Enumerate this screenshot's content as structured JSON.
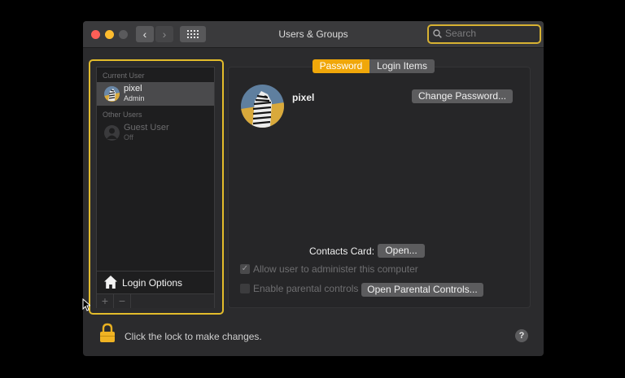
{
  "window": {
    "title": "Users & Groups",
    "nav_back_glyph": "‹",
    "nav_forward_glyph": "›",
    "grid_icon": "grid-icon"
  },
  "search": {
    "placeholder": "Search",
    "value": ""
  },
  "sidebar": {
    "current_user_label": "Current User",
    "other_users_label": "Other Users",
    "users": [
      {
        "name": "pixel",
        "role": "Admin",
        "selected": true
      },
      {
        "name": "Guest User",
        "role": "Off",
        "selected": false
      }
    ],
    "login_options_label": "Login Options",
    "add_glyph": "+",
    "remove_glyph": "−"
  },
  "tabs": {
    "items": [
      {
        "label": "Password",
        "active": true
      },
      {
        "label": "Login Items",
        "active": false
      }
    ]
  },
  "account": {
    "username": "pixel",
    "change_password_label": "Change Password...",
    "contacts_card_label": "Contacts Card:",
    "open_label": "Open...",
    "allow_admin_label": "Allow user to administer this computer",
    "allow_admin_checked": true,
    "parental_label": "Enable parental controls",
    "parental_checked": false,
    "open_parental_label": "Open Parental Controls..."
  },
  "footer": {
    "lock_text": "Click the lock to make changes.",
    "help_glyph": "?"
  },
  "colors": {
    "accent": "#f0a70a",
    "focus_ring": "#e3bc2b",
    "close": "#fe5f57",
    "minimize": "#febc2e"
  }
}
